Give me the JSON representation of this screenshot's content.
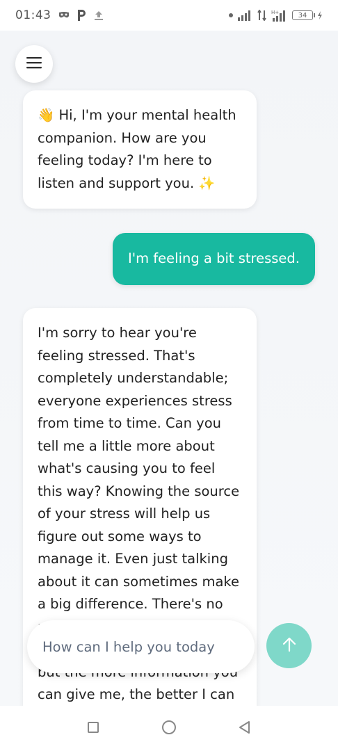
{
  "status_bar": {
    "time": "01:43",
    "icons_left": [
      "mask-icon",
      "p-icon",
      "upload-icon"
    ],
    "battery": "34",
    "icons_right": [
      "dot-icon",
      "signal-icon",
      "data-arrows-icon",
      "hd-signal-icon",
      "battery-icon",
      "charging-icon"
    ]
  },
  "header": {
    "menu_icon": "hamburger-menu-icon"
  },
  "messages": [
    {
      "role": "assistant",
      "text": "👋 Hi, I'm your mental health companion. How are you feeling today? I'm here to listen and support you. ✨"
    },
    {
      "role": "user",
      "text": "I'm feeling a bit stressed."
    },
    {
      "role": "assistant",
      "text": "I'm sorry to hear you're feeling stressed. That's completely understandable; everyone experiences stress from time to time. Can you tell me a little more about what's causing you to feel this way? Knowing the source of your stress will help us figure out some ways to manage it. Even just talking about it can sometimes make a big difference. There's no pressure to share anything you're not comfortable with, but the more information you can give me, the better I can assist you. Perhaps we could"
    }
  ],
  "composer": {
    "placeholder": "How can I help you today",
    "send_icon": "arrow-up-icon",
    "colors": {
      "accent": "#18b9a0",
      "send_disabled": "#7fd8c9"
    }
  },
  "nav_bar": {
    "items": [
      "recents-square-icon",
      "home-circle-icon",
      "back-triangle-icon"
    ]
  }
}
